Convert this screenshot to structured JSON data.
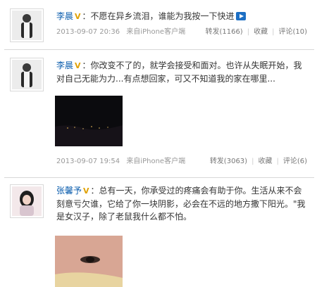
{
  "posts": [
    {
      "author": "李晨",
      "content": "不愿在异乡流泪，谁能为我按一下快进",
      "timestamp": "2013-09-07 20:36",
      "source": "来自iPhone客户端",
      "repost": "转发(1166)",
      "favorite": "收藏",
      "comment": "评论(10)",
      "icons": [
        "vip-badge-icon",
        "video-play-icon"
      ]
    },
    {
      "author": "李晨",
      "content": "你改变不了的，就学会接受和面对。也许从失眠开始，我对自己无能为力...有点想回家，可又不知道我的家在哪里...",
      "timestamp": "2013-09-07 19:54",
      "source": "来自iPhone客户端",
      "repost": "转发(3063)",
      "favorite": "收藏",
      "comment": "评论(6)",
      "image": "night-city-photo"
    },
    {
      "author": "张馨予",
      "content": "总有一天，你承受过的疼痛会有助于你。生活从来不会刻意亏欠谁，它给了你一块阴影，必会在不远的地方撒下阳光。\"我是女汉子，除了老鼠我什么都不怕。",
      "image": "face-photo"
    }
  ],
  "colors": {
    "name": "#0a5cad",
    "meta": "#999999",
    "vip": "#e0a100",
    "divider": "#d8d8d8"
  }
}
